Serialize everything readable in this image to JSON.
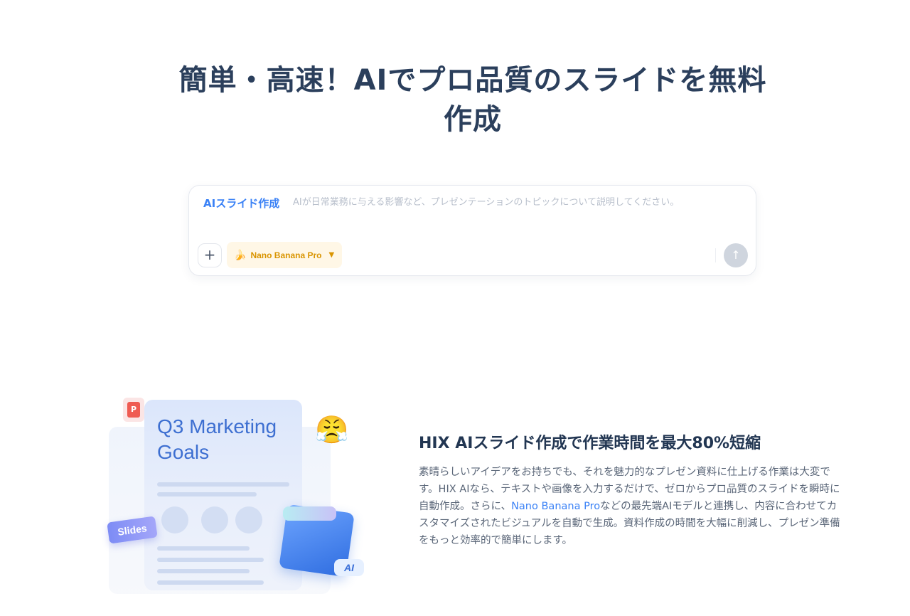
{
  "hero": {
    "title": "簡単・高速！AIでプロ品質のスライドを無料作成"
  },
  "prompt": {
    "label": "AIスライド作成",
    "placeholder": "AIが日常業務に与える影響など、プレゼンテーションのトピックについて説明してください。",
    "plus_symbol": "+",
    "model_name": "Nano Banana Pro",
    "model_icon": "banana-icon",
    "send_icon": "arrow-up-icon"
  },
  "illustration": {
    "sheet_title": "Q3 Marketing Goals",
    "ppt_letter": "P",
    "slides_tag": "Slides",
    "ai_tag": "AI"
  },
  "feature": {
    "title": "HIX AIスライド作成で作業時間を最大80%短縮",
    "body_before": "素晴らしいアイデアをお持ちでも、それを魅力的なプレゼン資料に仕上げる作業は大変です。HIX AIなら、テキストや画像を入力するだけで、ゼロからプロ品質のスライドを瞬時に自動作成。さらに、",
    "body_link": "Nano Banana Pro",
    "body_after": "などの最先端AIモデルと連携し、内容に合わせてカスタマイズされたビジュアルを自動で生成。資料作成の時間を大幅に削減し、プレゼン準備をもっと効率的で簡単にします。"
  },
  "colors": {
    "accent": "#3b82f6",
    "title": "#2b3f5c",
    "model_bg": "#fff7e6",
    "model_text": "#d99400"
  }
}
